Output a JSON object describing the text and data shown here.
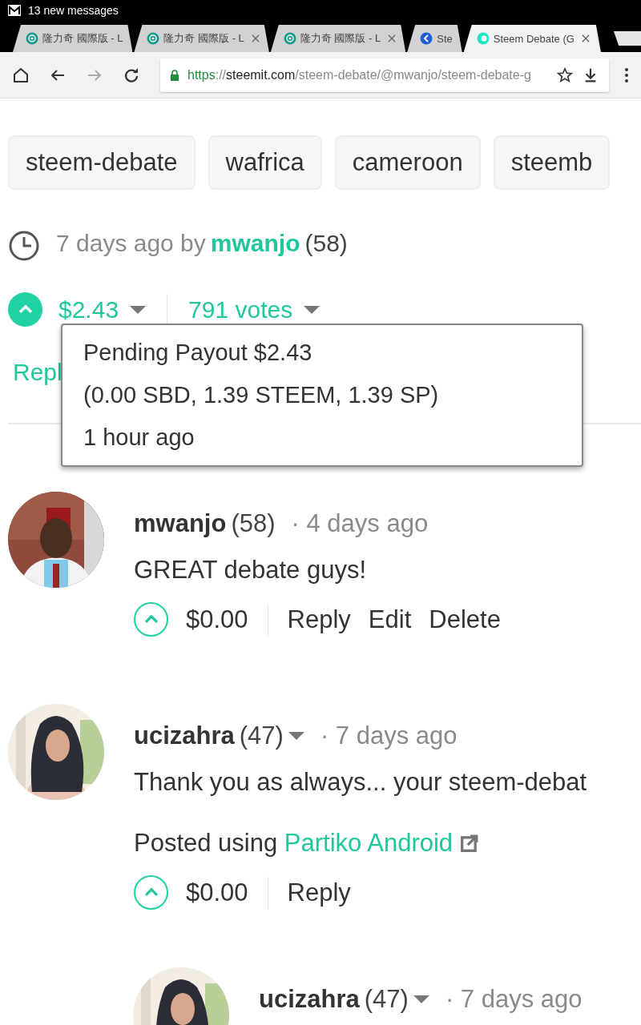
{
  "status_bar": {
    "notification": "13 new messages"
  },
  "tabs": [
    {
      "title": "隆力奇 國際版 - L",
      "selected": false,
      "closable": false,
      "kind": "globe"
    },
    {
      "title": "隆力奇 國際版 - L",
      "selected": false,
      "closable": true,
      "kind": "globe"
    },
    {
      "title": "隆力奇 國際版 - L",
      "selected": false,
      "closable": true,
      "kind": "globe"
    },
    {
      "title": "Ste",
      "selected": false,
      "closable": false,
      "kind": "blue"
    },
    {
      "title": "Steem Debate (G",
      "selected": true,
      "closable": true,
      "kind": "steem"
    }
  ],
  "address_bar": {
    "secure": true,
    "parts": [
      {
        "text": "https",
        "kind": "scheme"
      },
      {
        "text": "://",
        "kind": "dim"
      },
      {
        "text": "steemit.com",
        "kind": "host"
      },
      {
        "text": "/steem-debate/@mwanjo/steem-debate-g",
        "kind": "dim"
      }
    ]
  },
  "post": {
    "tags": [
      "steem-debate",
      "wafrica",
      "cameroon",
      "steemb"
    ],
    "time": "7 days ago by",
    "author": "mwanjo",
    "reputation": "(58)",
    "payout": "$2.43",
    "votes": "791 votes",
    "reply": "Repl",
    "tooltip": [
      "Pending Payout $2.43",
      "(0.00 SBD, 1.39 STEEM, 1.39 SP)",
      "1 hour ago"
    ]
  },
  "comments": [
    {
      "author": "mwanjo",
      "reputation": "(58)",
      "menu": false,
      "time": "· 4 days ago",
      "nested": false,
      "body": [
        {
          "kind": "text",
          "text": "GREAT debate guys!"
        }
      ],
      "payout": "$0.00",
      "actions": [
        "Reply",
        "Edit",
        "Delete"
      ]
    },
    {
      "author": "ucizahra",
      "reputation": "(47)",
      "menu": true,
      "time": "· 7 days ago",
      "nested": false,
      "body": [
        {
          "kind": "text",
          "text": "Thank you as always... your steem-debat"
        },
        {
          "kind": "link",
          "text": "Posted using ",
          "link": "Partiko Android"
        }
      ],
      "payout": "$0.00",
      "actions": [
        "Reply"
      ]
    },
    {
      "author": "ucizahra",
      "reputation": "(47)",
      "menu": true,
      "time": "· 7 days ago",
      "nested": true
    }
  ]
}
